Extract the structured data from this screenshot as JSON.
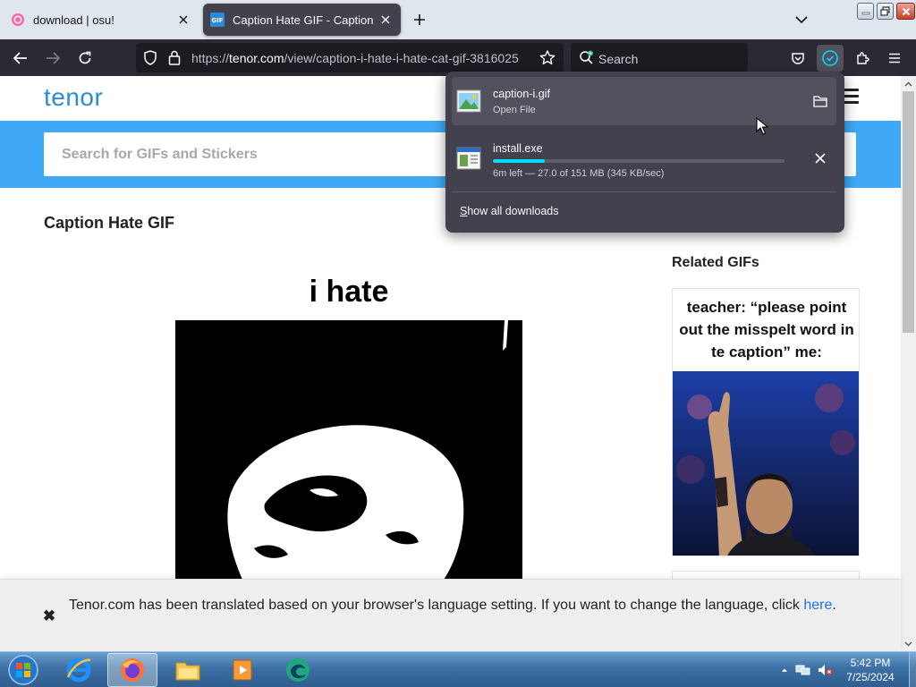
{
  "browser": {
    "tabs": [
      {
        "title": "download | osu!"
      },
      {
        "title": "Caption Hate GIF - Caption I Hate"
      }
    ],
    "url": {
      "prefix": "https://",
      "host": "tenor.com",
      "path": "/view/caption-i-hate-i-hate-cat-gif-3816025"
    },
    "search_placeholder": "Search"
  },
  "downloads_panel": {
    "items": [
      {
        "name": "caption-i.gif",
        "status": "Open File"
      },
      {
        "name": "install.exe",
        "status": "6m left — 27.0 of 151 MB (345 KB/sec)",
        "progress_percent": 17.9
      }
    ],
    "show_all_accel": "S",
    "show_all_rest": "how all downloads"
  },
  "page": {
    "logo": "tenor",
    "search_placeholder": "Search for GIFs and Stickers",
    "title": "Caption Hate GIF",
    "main_gif_caption": "i hate",
    "related_title": "Related GIFs",
    "related_gif_caption": "teacher: “please point out the misspelt word in te caption” me:"
  },
  "notice": {
    "text": "Tenor.com has been translated based on your browser's language setting. If you want to change the language, click",
    "link": "here",
    "end": "."
  },
  "taskbar": {
    "time": "5:42 PM",
    "date": "7/25/2024"
  },
  "colors": {
    "tenor_blue": "#3fa9f5",
    "download_progress": "#00ddff",
    "panel_bg": "#42414d"
  }
}
